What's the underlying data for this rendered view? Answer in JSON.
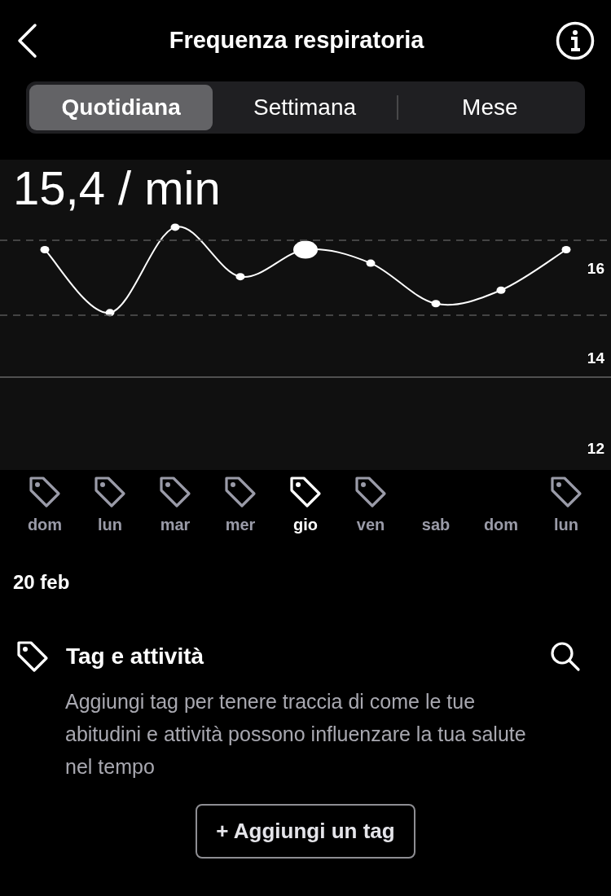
{
  "header": {
    "title": "Frequenza respiratoria"
  },
  "tabs": [
    {
      "label": "Quotidiana",
      "selected": true
    },
    {
      "label": "Settimana",
      "selected": false
    },
    {
      "label": "Mese",
      "selected": false
    }
  ],
  "reading": "15,4 / min",
  "chart": {
    "chart_data": {
      "type": "line",
      "categories": [
        "dom",
        "lun",
        "mar",
        "mer",
        "gio",
        "ven",
        "sab",
        "dom",
        "lun"
      ],
      "series": [
        {
          "color": "#ffffff",
          "marker": "o",
          "values": [
            16.4,
            15.0,
            16.9,
            15.8,
            16.4,
            16.1,
            15.2,
            15.5,
            16.4
          ]
        }
      ],
      "ylim": [
        11.5,
        18.4
      ],
      "yticks": [
        12,
        14,
        16
      ]
    }
  },
  "days": [
    {
      "tag": true,
      "selected": false
    },
    {
      "tag": true,
      "selected": false
    },
    {
      "tag": true,
      "selected": false
    },
    {
      "tag": true,
      "selected": false
    },
    {
      "tag": true,
      "selected": true
    },
    {
      "tag": true,
      "selected": false
    },
    {
      "tag": false,
      "selected": false
    },
    {
      "tag": false,
      "selected": false
    },
    {
      "tag": true,
      "selected": false
    }
  ],
  "date": "20 feb",
  "tags_section": {
    "title": "Tag e attività",
    "description": "Aggiungi tag per tenere traccia di come le tue abitudini e attività possono influenzare la tua salute nel tempo",
    "button": "+ Aggiungi un tag"
  }
}
